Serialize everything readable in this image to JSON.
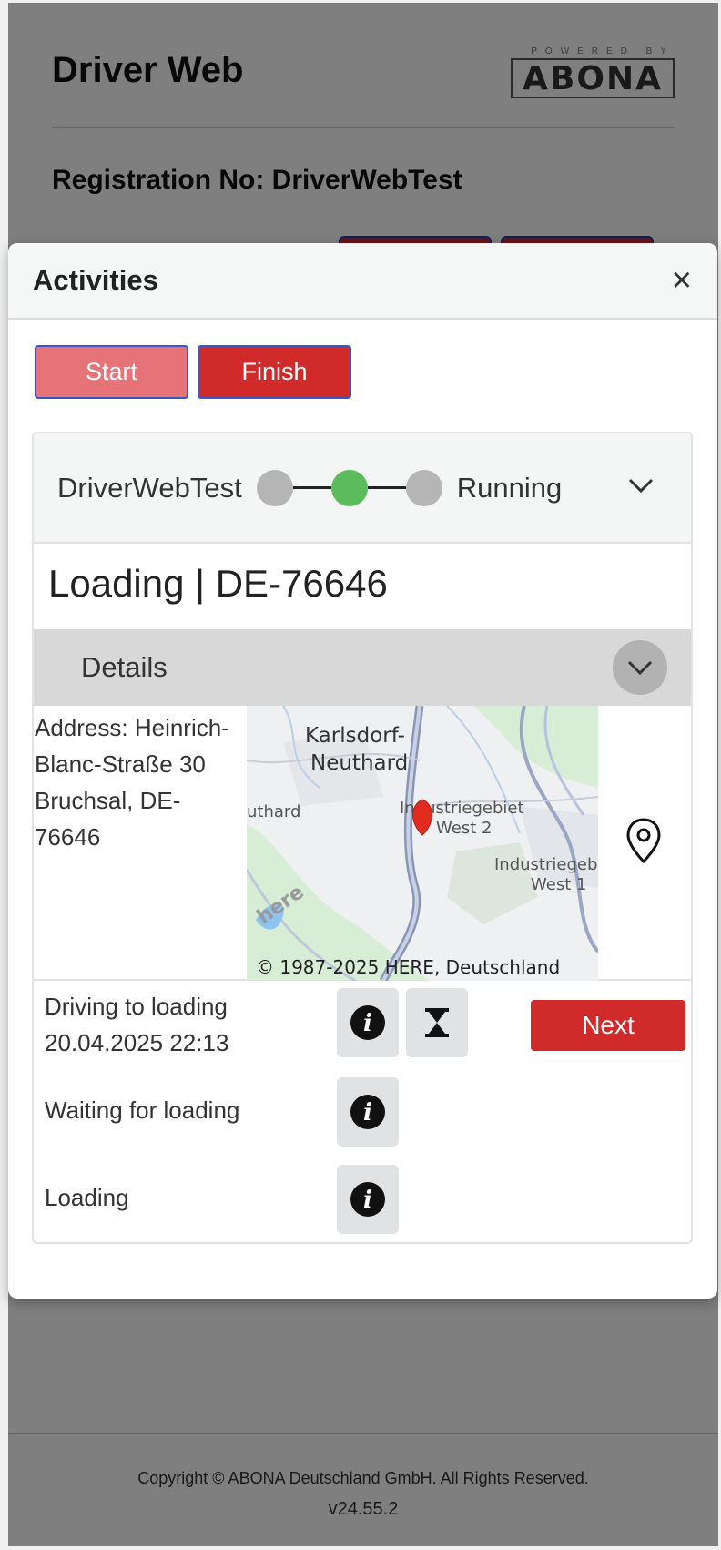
{
  "app": {
    "title": "Driver Web",
    "logo_tagline": "POWERED BY",
    "logo_text": "ABONA",
    "registration": "Registration No: DriverWebTest"
  },
  "footer": {
    "copyright": "Copyright © ABONA Deutschland GmbH. All Rights Reserved.",
    "version": "v24.55.2"
  },
  "modal": {
    "title": "Activities",
    "close_icon": "×",
    "start_label": "Start",
    "finish_label": "Finish",
    "trip": {
      "vehicle": "DriverWebTest",
      "status": "Running",
      "steps": [
        "inactive",
        "active",
        "inactive"
      ]
    },
    "section_title": "Loading | DE-76646",
    "details_label": "Details",
    "address_text": "Address: Heinrich-Blanc-Straße 30 Bruchsal, DE-76646",
    "map": {
      "labels": [
        "Karlsdorf-",
        "Neuthard",
        "uthard",
        "Industriegebiet",
        "West 2",
        "Industriegebiet",
        "West 1",
        "here"
      ],
      "attribution": "© 1987-2025 HERE, Deutschland"
    },
    "activities": [
      {
        "label": "Driving to loading",
        "datetime": "20.04.2025 22:13",
        "icons": [
          "info-icon",
          "hourglass-icon"
        ],
        "action": "Next"
      },
      {
        "label": "Waiting for loading",
        "icons": [
          "info-icon"
        ]
      },
      {
        "label": "Loading",
        "icons": [
          "info-icon"
        ]
      }
    ]
  },
  "colors": {
    "primary_red": "#d12a2a",
    "disabled_red": "#e57377",
    "active_step": "#5cbc5c",
    "inactive_step": "#b5b5b5"
  }
}
